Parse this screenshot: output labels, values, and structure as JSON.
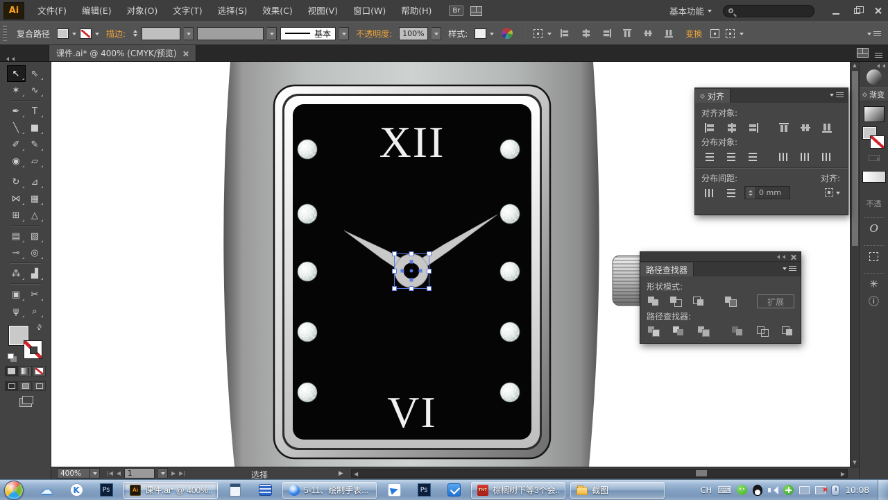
{
  "colors": {
    "accent_orange": "#eda43b",
    "selection_blue": "#5b79e3",
    "panel_bg": "#454545",
    "canvas_white": "#ffffff",
    "watch_face": "#050505",
    "metal_light": "#cdd1d0"
  },
  "menubar": {
    "app_logo": "Ai",
    "menus": [
      "文件(F)",
      "编辑(E)",
      "对象(O)",
      "文字(T)",
      "选择(S)",
      "效果(C)",
      "视图(V)",
      "窗口(W)",
      "帮助(H)"
    ],
    "br_label": "Br",
    "workspace": "基本功能"
  },
  "controlbar": {
    "context_label": "复合路径",
    "stroke_label": "描边:",
    "line_style": "基本",
    "opacity_label": "不透明度:",
    "opacity_value": "100%",
    "style_label": "样式:",
    "transform_label": "变换"
  },
  "tabbar": {
    "doc_title": "课件.ai* @ 400% (CMYK/预览)"
  },
  "toolbar": {
    "tools": [
      {
        "name": "selection-tool",
        "glyph": "↖",
        "active": true
      },
      {
        "name": "direct-selection-tool",
        "glyph": "⇖"
      },
      {
        "name": "magic-wand-tool",
        "glyph": "✶"
      },
      {
        "name": "lasso-tool",
        "glyph": "∿"
      },
      {
        "name": "pen-tool",
        "glyph": "✒"
      },
      {
        "name": "type-tool",
        "glyph": "T"
      },
      {
        "name": "line-segment-tool",
        "glyph": "╲"
      },
      {
        "name": "rectangle-tool",
        "glyph": "■"
      },
      {
        "name": "paintbrush-tool",
        "glyph": "✐"
      },
      {
        "name": "pencil-tool",
        "glyph": "✎"
      },
      {
        "name": "blob-brush-tool",
        "glyph": "◉"
      },
      {
        "name": "eraser-tool",
        "glyph": "▱"
      },
      {
        "name": "rotate-tool",
        "glyph": "↻"
      },
      {
        "name": "scale-tool",
        "glyph": "⊿"
      },
      {
        "name": "width-tool",
        "glyph": "⋈"
      },
      {
        "name": "free-transform-tool",
        "glyph": "▦"
      },
      {
        "name": "shape-builder-tool",
        "glyph": "⊞"
      },
      {
        "name": "perspective-grid-tool",
        "glyph": "△"
      },
      {
        "name": "mesh-tool",
        "glyph": "▤"
      },
      {
        "name": "gradient-tool",
        "glyph": "▧"
      },
      {
        "name": "eyedropper-tool",
        "glyph": "⊸"
      },
      {
        "name": "blend-tool",
        "glyph": "◎"
      },
      {
        "name": "symbol-sprayer-tool",
        "glyph": "⁂"
      },
      {
        "name": "column-graph-tool",
        "glyph": "▟"
      },
      {
        "name": "artboard-tool",
        "glyph": "▣"
      },
      {
        "name": "slice-tool",
        "glyph": "✂"
      },
      {
        "name": "hand-tool",
        "glyph": "ψ"
      },
      {
        "name": "zoom-tool",
        "glyph": "⌕"
      }
    ]
  },
  "watch": {
    "numeral_top": "XII",
    "numeral_bottom": "VI"
  },
  "align_panel": {
    "title": "对齐",
    "align_objects_label": "对齐对象:",
    "distribute_objects_label": "分布对象:",
    "distribute_spacing_label": "分布间距:",
    "align_to_label": "对齐:",
    "spacing_value": "0 mm",
    "align_buttons": [
      {
        "name": "horizontal-align-left",
        "cls": "al-l"
      },
      {
        "name": "horizontal-align-center",
        "cls": "al-c"
      },
      {
        "name": "horizontal-align-right",
        "cls": "al-r"
      },
      {
        "name": "vertical-align-top",
        "cls": "al-t"
      },
      {
        "name": "vertical-align-center",
        "cls": "al-m"
      },
      {
        "name": "vertical-align-bottom",
        "cls": "al-b"
      }
    ],
    "distribute_buttons": [
      {
        "name": "vertical-distribute-top",
        "cls": "di-h"
      },
      {
        "name": "vertical-distribute-center",
        "cls": "di-h"
      },
      {
        "name": "vertical-distribute-bottom",
        "cls": "di-h"
      },
      {
        "name": "horizontal-distribute-left",
        "cls": "di-v"
      },
      {
        "name": "horizontal-distribute-center",
        "cls": "di-v"
      },
      {
        "name": "horizontal-distribute-right",
        "cls": "di-v"
      }
    ],
    "spacing_buttons": [
      {
        "name": "vertical-distribute-space",
        "cls": "di-h"
      },
      {
        "name": "horizontal-distribute-space",
        "cls": "di-v"
      }
    ]
  },
  "pathfinder_panel": {
    "title": "路径查找器",
    "shape_modes_label": "形状模式:",
    "expand_button": "扩展",
    "pathfinder_label": "路径查找器:",
    "shape_mode_buttons": [
      {
        "name": "unite",
        "cls": "pf-unite"
      },
      {
        "name": "minus-front",
        "cls": "pf-minus"
      },
      {
        "name": "intersect",
        "cls": "pf-intersect"
      },
      {
        "name": "exclude",
        "cls": "pf-exclude"
      }
    ],
    "pathfinder_buttons": [
      {
        "name": "divide",
        "cls": "pf-divide"
      },
      {
        "name": "trim",
        "cls": "pf-trim"
      },
      {
        "name": "merge",
        "cls": "pf-merge"
      },
      {
        "name": "crop",
        "cls": "pf-crop"
      },
      {
        "name": "outline",
        "cls": "pf-outline"
      },
      {
        "name": "minus-back",
        "cls": "pf-minusback"
      }
    ]
  },
  "gradient_panel": {
    "title": "渐变",
    "opacity_partial": "不透"
  },
  "statusbar": {
    "zoom_level": "400%",
    "artboard_number": "1",
    "status_text": "选择"
  },
  "taskbar": {
    "windows": [
      {
        "icon": "ai",
        "icon_text": "Ai",
        "label": "课件.ai* @ 400%...",
        "active": true
      },
      {
        "icon": "browser",
        "icon_text": "",
        "label": "5-11、绘制手表...",
        "active": false
      },
      {
        "icon": "tnt",
        "icon_text": "TNT",
        "label": "棕榈树下等3个会...",
        "active": false
      },
      {
        "icon": "folder",
        "icon_text": "",
        "label": "截图",
        "active": false
      }
    ],
    "tray": {
      "lang": "CH",
      "time": "10:08"
    }
  }
}
